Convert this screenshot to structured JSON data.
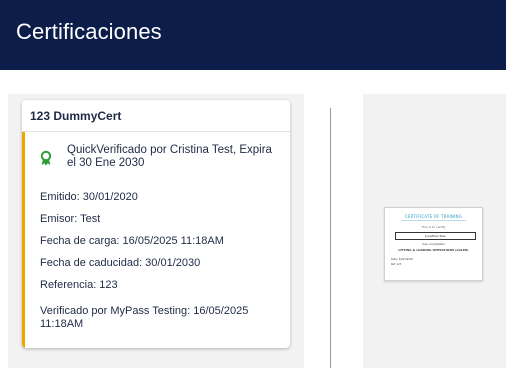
{
  "header": {
    "title": "Certificaciones"
  },
  "card": {
    "title": "123 DummyCert",
    "verification_text": "QuickVerificado por Cristina Test, Expira el 30 Ene 2030",
    "fields": {
      "emitido": "Emitido: 30/01/2020",
      "emisor": "Emisor: Test",
      "fecha_carga": "Fecha de carga: 16/05/2025 11:18AM",
      "fecha_caducidad": "Fecha de caducidad: 30/01/2030",
      "referencia": "Referencia: 123"
    },
    "verified_by": "Verificado por MyPass Testing: 16/05/2025 11:18AM"
  },
  "thumbnail": {
    "title": "CERTIFICATE OF TRAINING",
    "subtitle": "This is to certify",
    "name_box": "Jonathan Doe",
    "line1": "has completed",
    "line2": "LIFTING & LOADING OPERATIONS (LOLER)",
    "small1": "Date: 30/01/2020",
    "small2": "Ref: 123"
  },
  "colors": {
    "header_bg": "#0d1d4a",
    "accent_border": "#f0a500",
    "verified_icon": "#2e9e3a"
  },
  "icons": {
    "verified": "award-ribbon-icon"
  }
}
